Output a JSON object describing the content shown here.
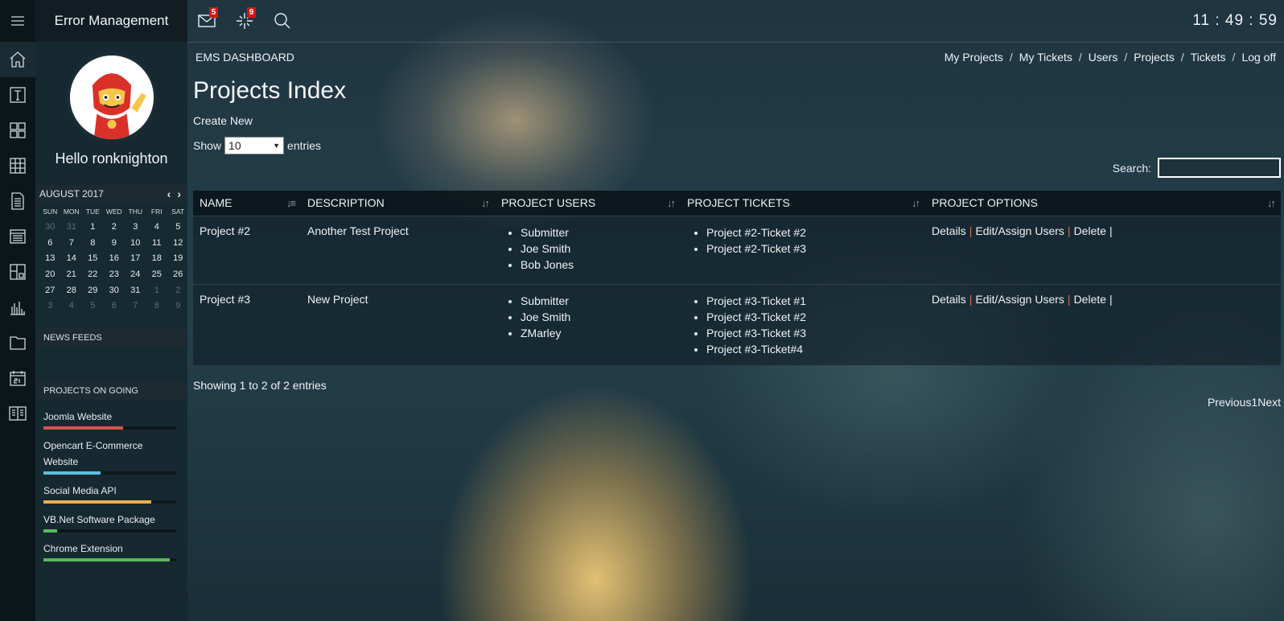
{
  "app": {
    "brand": "Error Management",
    "clock": "11 : 49 : 59",
    "hello": "Hello ronknighton"
  },
  "topbar": {
    "mail_badge": "5",
    "tasks_badge": "9"
  },
  "subbar": {
    "title": "EMS DASHBOARD",
    "links": [
      "My Projects",
      "My Tickets",
      "Users",
      "Projects",
      "Tickets",
      "Log off"
    ]
  },
  "calendar": {
    "month": "AUGUST 2017",
    "days_of_week": [
      "SUN",
      "MON",
      "TUE",
      "WED",
      "THU",
      "FRI",
      "SAT"
    ],
    "weeks": [
      [
        "30",
        "31",
        "1",
        "2",
        "3",
        "4",
        "5"
      ],
      [
        "6",
        "7",
        "8",
        "9",
        "10",
        "11",
        "12"
      ],
      [
        "13",
        "14",
        "15",
        "16",
        "17",
        "18",
        "19"
      ],
      [
        "20",
        "21",
        "22",
        "23",
        "24",
        "25",
        "26"
      ],
      [
        "27",
        "28",
        "29",
        "30",
        "31",
        "1",
        "2"
      ],
      [
        "3",
        "4",
        "5",
        "6",
        "7",
        "8",
        "9"
      ]
    ]
  },
  "news": {
    "title": "NEWS FEEDS"
  },
  "ongoing": {
    "title": "PROJECTS ON GOING",
    "items": [
      {
        "name": "Joomla Website",
        "progress": 0.6,
        "color": "#d9534f"
      },
      {
        "name": "Opencart E-Commerce Website",
        "progress": 0.43,
        "color": "#5bc0de"
      },
      {
        "name": "Social Media API",
        "progress": 0.81,
        "color": "#f0ad4e"
      },
      {
        "name": "VB.Net Software Package",
        "progress": 0.1,
        "color": "#5cb85c"
      },
      {
        "name": "Chrome Extension",
        "progress": 0.95,
        "color": "#5cb85c"
      }
    ]
  },
  "main": {
    "heading": "Projects Index",
    "create_new": "Create New",
    "show_label": "Show",
    "show_value": "10",
    "entries_label": "entries",
    "search_label": "Search:",
    "search_value": "",
    "columns": [
      "NAME",
      "DESCRIPTION",
      "PROJECT USERS",
      "PROJECT TICKETS",
      "PROJECT OPTIONS"
    ],
    "rows": [
      {
        "name": "Project #2",
        "description": "Another Test Project",
        "users": [
          "Submitter",
          "Joe Smith",
          "Bob Jones"
        ],
        "tickets": [
          "Project #2-Ticket #2",
          "Project #2-Ticket #3"
        ],
        "options": [
          "Details",
          "Edit/Assign Users",
          "Delete"
        ]
      },
      {
        "name": "Project #3",
        "description": "New Project",
        "users": [
          "Submitter",
          "Joe Smith",
          "ZMarley"
        ],
        "tickets": [
          "Project #3-Ticket #1",
          "Project #3-Ticket #2",
          "Project #3-Ticket #3",
          "Project #3-Ticket#4"
        ],
        "options": [
          "Details",
          "Edit/Assign Users",
          "Delete"
        ]
      }
    ],
    "info": "Showing 1 to 2 of 2 entries",
    "pager": {
      "previous": "Previous",
      "page": "1",
      "next": "Next"
    }
  }
}
